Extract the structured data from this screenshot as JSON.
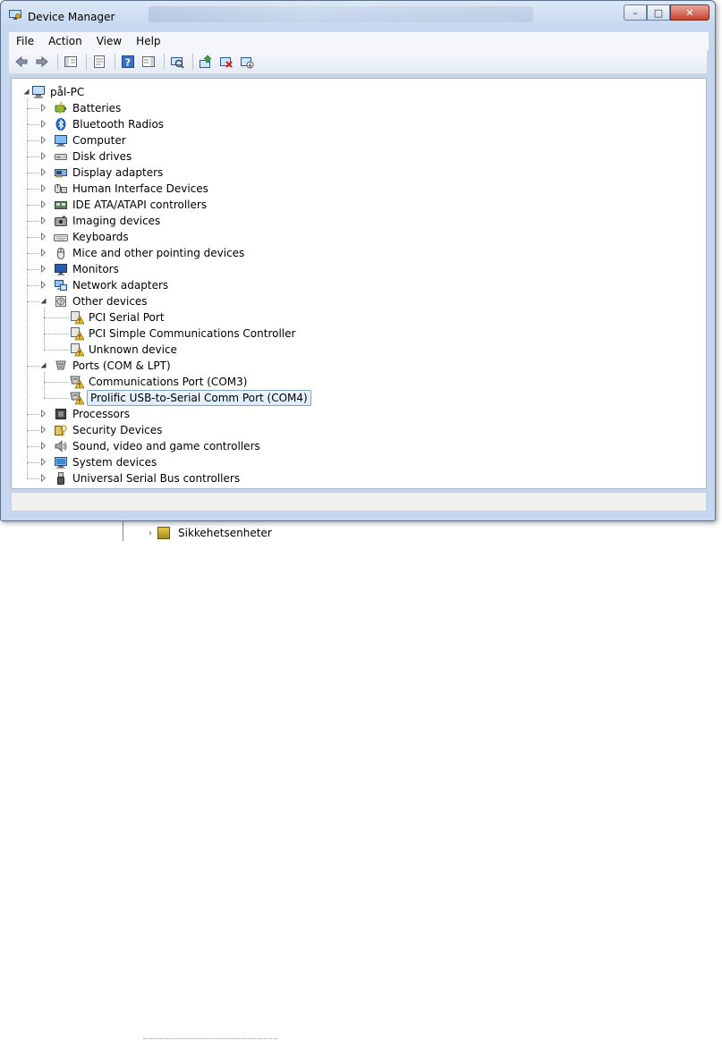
{
  "window": {
    "title": "Device Manager"
  },
  "menu": [
    "File",
    "Action",
    "View",
    "Help"
  ],
  "toolbar": [
    {
      "name": "back-icon"
    },
    {
      "name": "forward-icon"
    },
    {
      "sep": true
    },
    {
      "name": "show-hide-console-tree-icon"
    },
    {
      "sep": true
    },
    {
      "name": "properties-icon"
    },
    {
      "sep": true
    },
    {
      "name": "help-icon"
    },
    {
      "name": "show-action-pane-icon"
    },
    {
      "sep": true
    },
    {
      "name": "scan-hardware-icon"
    },
    {
      "sep": true
    },
    {
      "name": "update-driver-icon"
    },
    {
      "name": "uninstall-icon"
    },
    {
      "name": "disable-icon"
    }
  ],
  "tree": {
    "root": "pål-PC",
    "items": [
      {
        "label": "Batteries",
        "icon": "battery-icon",
        "expanded": false
      },
      {
        "label": "Bluetooth Radios",
        "icon": "bluetooth-icon",
        "expanded": false
      },
      {
        "label": "Computer",
        "icon": "computer-icon",
        "expanded": false
      },
      {
        "label": "Disk drives",
        "icon": "disk-drive-icon",
        "expanded": false
      },
      {
        "label": "Display adapters",
        "icon": "display-adapter-icon",
        "expanded": false
      },
      {
        "label": "Human Interface Devices",
        "icon": "hid-icon",
        "expanded": false
      },
      {
        "label": "IDE ATA/ATAPI controllers",
        "icon": "ide-controller-icon",
        "expanded": false
      },
      {
        "label": "Imaging devices",
        "icon": "imaging-device-icon",
        "expanded": false
      },
      {
        "label": "Keyboards",
        "icon": "keyboard-icon",
        "expanded": false
      },
      {
        "label": "Mice and other pointing devices",
        "icon": "mouse-icon",
        "expanded": false
      },
      {
        "label": "Monitors",
        "icon": "monitor-icon",
        "expanded": false
      },
      {
        "label": "Network adapters",
        "icon": "network-adapter-icon",
        "expanded": false
      },
      {
        "label": "Other devices",
        "icon": "other-devices-icon",
        "expanded": true,
        "children": [
          {
            "label": "PCI Serial Port",
            "icon": "warning-device-icon"
          },
          {
            "label": "PCI Simple Communications Controller",
            "icon": "warning-device-icon"
          },
          {
            "label": "Unknown device",
            "icon": "warning-device-icon"
          }
        ]
      },
      {
        "label": "Ports (COM & LPT)",
        "icon": "port-icon",
        "expanded": true,
        "children": [
          {
            "label": "Communications Port (COM3)",
            "icon": "warning-port-icon"
          },
          {
            "label": "Prolific USB-to-Serial Comm Port (COM4)",
            "icon": "warning-port-icon",
            "selected": true
          }
        ]
      },
      {
        "label": "Processors",
        "icon": "processor-icon",
        "expanded": false
      },
      {
        "label": "Security Devices",
        "icon": "security-device-icon",
        "expanded": false
      },
      {
        "label": "Sound, video and game controllers",
        "icon": "sound-icon",
        "expanded": false
      },
      {
        "label": "System devices",
        "icon": "system-device-icon",
        "expanded": false
      },
      {
        "label": "Universal Serial Bus controllers",
        "icon": "usb-icon",
        "expanded": false
      }
    ]
  },
  "background": {
    "item_label": "Sikkehetsenheter"
  }
}
